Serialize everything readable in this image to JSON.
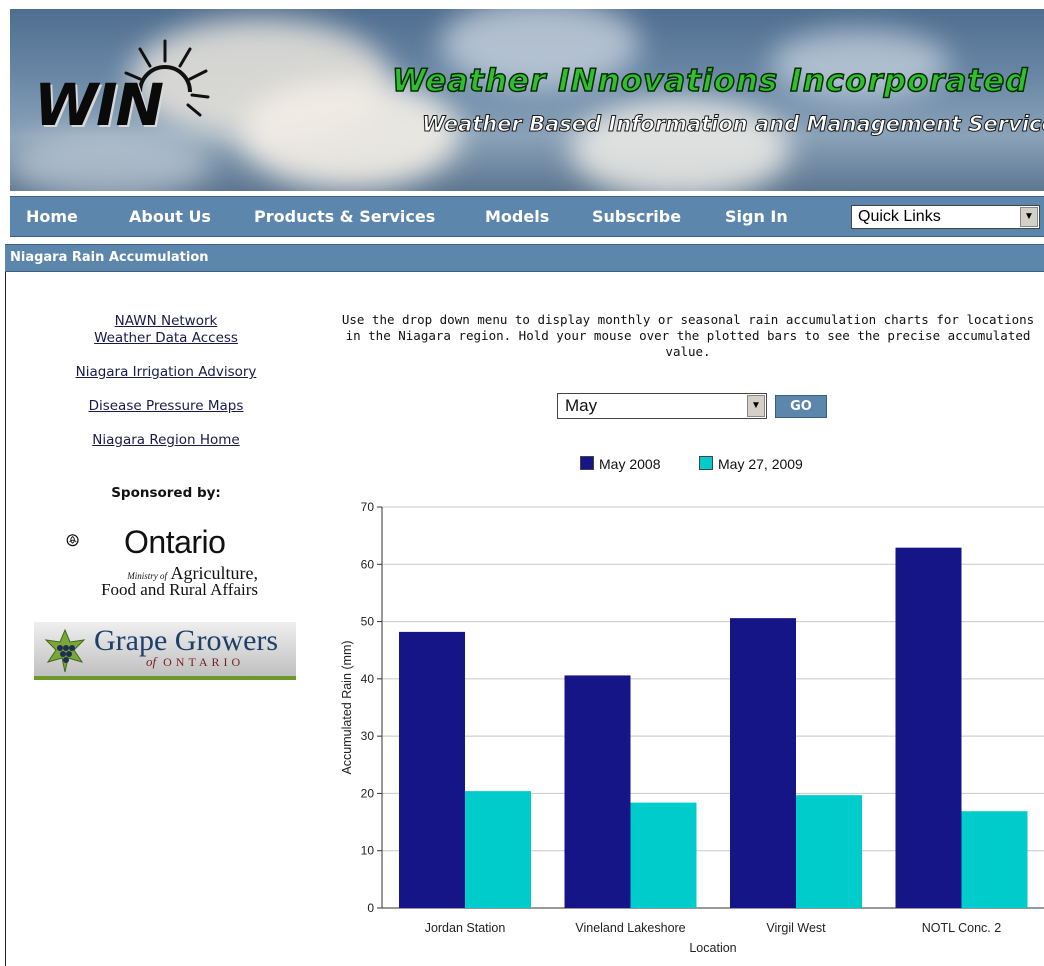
{
  "brand": {
    "logo_text": "WIN",
    "company": "Weather INnovations Incorporated",
    "tagline": "Weather Based Information and Management Services"
  },
  "nav": {
    "items": [
      "Home",
      "About Us",
      "Products & Services",
      "Models",
      "Subscribe",
      "Sign In"
    ],
    "quick_links": "Quick Links"
  },
  "page_title": "Niagara Rain Accumulation",
  "sidebar": {
    "links": [
      {
        "line1": "NAWN Network",
        "line2": "Weather Data Access"
      },
      {
        "line1": "Niagara Irrigation Advisory"
      },
      {
        "line1": "Disease Pressure Maps"
      },
      {
        "line1": "Niagara Region Home"
      }
    ],
    "sponsored_label": "Sponsored by:",
    "ontario": {
      "name": "Ontario",
      "ministry_small": "Ministry of",
      "ministry_big": "Agriculture,",
      "ministry_line2": "Food and Rural Affairs"
    },
    "grape": {
      "name": "Grape Growers",
      "of": "of",
      "region": "ONTARIO"
    }
  },
  "main": {
    "intro": "Use the drop down menu to display monthly or seasonal rain accumulation charts for locations in the Niagara region. Hold your mouse over the plotted bars to see the precise accumulated value.",
    "month_select": "May",
    "go_label": "GO"
  },
  "colors": {
    "nav_bg": "#5d86ad",
    "series1": "#151588",
    "series2": "#00cccc"
  },
  "chart_data": {
    "type": "bar",
    "categories": [
      "Jordan Station",
      "Vineland Lakeshore",
      "Virgil West",
      "NOTL Conc. 2"
    ],
    "series": [
      {
        "name": "May 2008",
        "values": [
          48.2,
          40.6,
          50.6,
          62.9
        ]
      },
      {
        "name": "May 27, 2009",
        "values": [
          20.4,
          18.4,
          19.7,
          16.9
        ]
      }
    ],
    "xlabel": "Location",
    "ylabel": "Accumulated Rain (mm)",
    "ylim": [
      0,
      70
    ],
    "yticks": [
      0,
      10,
      20,
      30,
      40,
      50,
      60,
      70
    ],
    "grid": true,
    "legend": "top-center"
  }
}
